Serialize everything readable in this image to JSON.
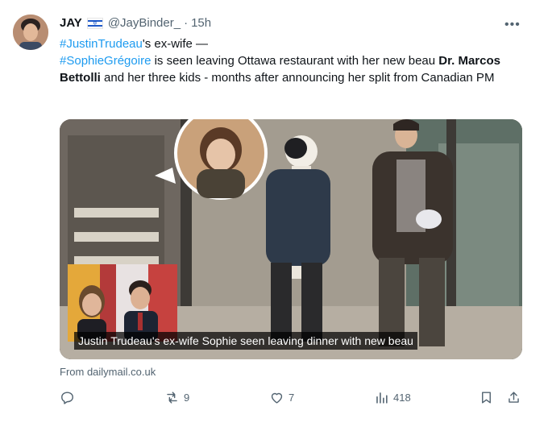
{
  "author": {
    "name": "JAY",
    "handle": "@JayBinder_",
    "separator": "·",
    "time": "15h"
  },
  "menu": {
    "more_label": "•••"
  },
  "tweet": {
    "tag1": "#JustinTrudeau",
    "text1": "'s ex-wife —",
    "tag2": "#SophieGrégoire",
    "text2": " is seen leaving Ottawa restaurant with her new beau ",
    "bold": "Dr. Marcos Bettolli",
    "text3": " and her three kids - months after announcing her split from Canadian PM"
  },
  "media": {
    "caption": "Justin Trudeau's ex-wife Sophie seen leaving dinner with new beau"
  },
  "source": "From dailymail.co.uk",
  "stats": {
    "reposts": "9",
    "likes": "7",
    "views": "418"
  },
  "colors": {
    "link": "#1d9bf0",
    "secondary_text": "#536471"
  }
}
